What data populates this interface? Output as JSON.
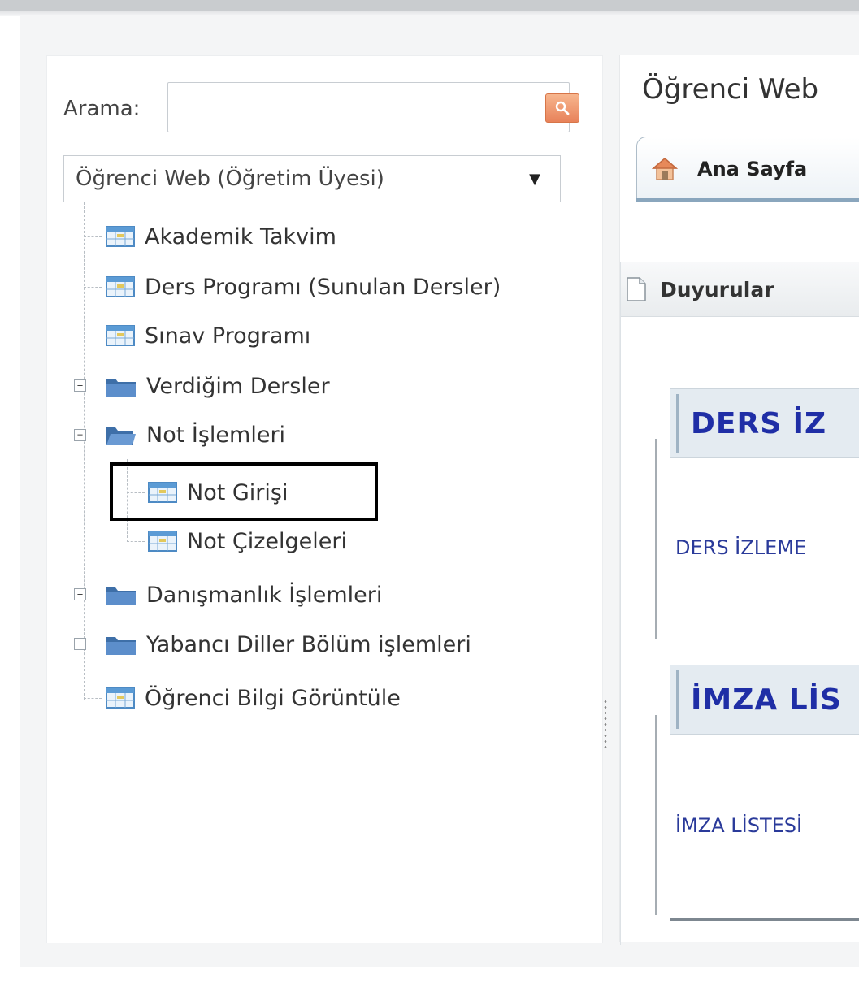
{
  "nav": {
    "search_label": "Arama:",
    "search_placeholder": "",
    "module_selected": "Öğrenci Web (Öğretim Üyesi)",
    "tree": [
      {
        "label": "Akademik Takvim",
        "icon": "table-icon",
        "type": "item"
      },
      {
        "label": "Ders Programı (Sunulan Dersler)",
        "icon": "table-icon",
        "type": "item"
      },
      {
        "label": "Sınav Programı",
        "icon": "table-icon",
        "type": "item"
      },
      {
        "label": "Verdiğim Dersler",
        "icon": "folder-icon",
        "type": "folder",
        "state": "collapsed"
      },
      {
        "label": "Not İşlemleri",
        "icon": "folder-open-icon",
        "type": "folder",
        "state": "expanded"
      },
      {
        "label": "Not Girişi",
        "icon": "table-icon",
        "type": "child",
        "highlighted": true
      },
      {
        "label": "Not Çizelgeleri",
        "icon": "table-icon",
        "type": "child"
      },
      {
        "label": "Danışmanlık İşlemleri",
        "icon": "folder-icon",
        "type": "folder",
        "state": "collapsed"
      },
      {
        "label": "Yabancı Diller Bölüm işlemleri",
        "icon": "folder-icon",
        "type": "folder",
        "state": "collapsed"
      },
      {
        "label": "Öğrenci Bilgi Görüntüle",
        "icon": "table-icon",
        "type": "item"
      }
    ]
  },
  "content": {
    "title": "Öğrenci Web",
    "home_tab_label": "Ana Sayfa",
    "portlet_title": "Duyurular",
    "sections": [
      {
        "title": "DERS İZ",
        "link": "DERS İZLEME"
      },
      {
        "title": "İMZA LİS",
        "link": "İMZA LİSTESİ"
      }
    ]
  },
  "colors": {
    "section_title": "#1f2ea6",
    "search_button": "#e8825a",
    "tab_accent": "#8aa6bd"
  }
}
